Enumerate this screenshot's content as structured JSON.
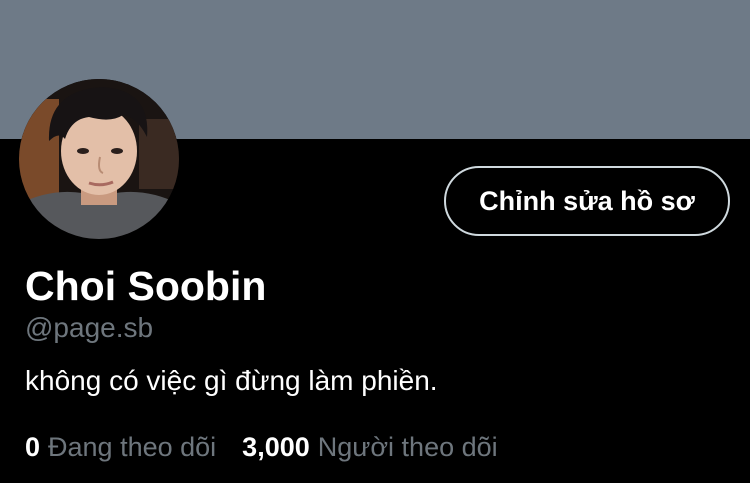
{
  "profile": {
    "name": "Choi Soobin",
    "handle": "@page.sb",
    "bio": "không có việc gì đừng làm phiền.",
    "edit_button_label": "Chỉnh sửa hồ sơ",
    "following": {
      "count": "0",
      "label": "Đang theo dõi"
    },
    "followers": {
      "count": "3,000",
      "label": "Người theo dõi"
    }
  },
  "colors": {
    "banner": "#6e7a87",
    "background": "#000000",
    "primary_text": "#ffffff",
    "secondary_text": "#6e767d",
    "button_border": "#cfd9de"
  },
  "icons": {
    "avatar": "profile-photo"
  }
}
